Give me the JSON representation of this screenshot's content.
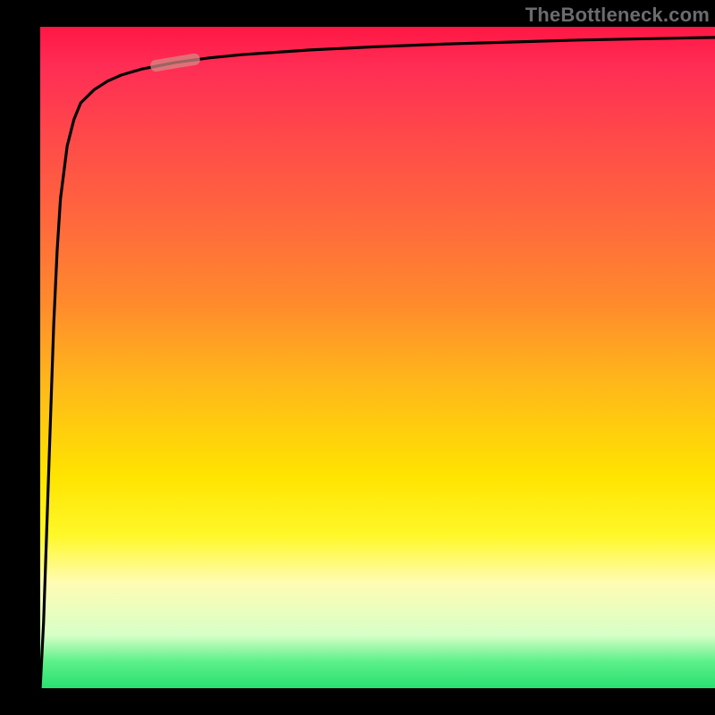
{
  "attribution": "TheBottleneck.com",
  "chart_data": {
    "type": "line",
    "title": "",
    "xlabel": "",
    "ylabel": "",
    "xlim": [
      0,
      100
    ],
    "ylim": [
      0,
      100
    ],
    "background_gradient": {
      "orientation": "vertical",
      "stops": [
        {
          "pos": 0,
          "color": "#ff1744"
        },
        {
          "pos": 30,
          "color": "#ff6a3c"
        },
        {
          "pos": 55,
          "color": "#ffb81a"
        },
        {
          "pos": 75,
          "color": "#fff82a"
        },
        {
          "pos": 92,
          "color": "#d7ffc7"
        },
        {
          "pos": 100,
          "color": "#28e070"
        }
      ]
    },
    "series": [
      {
        "name": "curve",
        "x": [
          0.0,
          0.5,
          1.0,
          1.5,
          2.0,
          2.5,
          3.0,
          4.0,
          5.0,
          6.0,
          8.0,
          10.0,
          12.0,
          15.0,
          20.0,
          25.0,
          30.0,
          40.0,
          50.0,
          60.0,
          70.0,
          80.0,
          90.0,
          100.0
        ],
        "y": [
          0.0,
          10.0,
          25.0,
          40.0,
          55.0,
          66.0,
          74.0,
          82.0,
          86.0,
          88.5,
          90.5,
          91.8,
          92.7,
          93.6,
          94.6,
          95.3,
          95.8,
          96.5,
          97.0,
          97.4,
          97.7,
          98.0,
          98.2,
          98.4
        ]
      }
    ],
    "marker": {
      "x": 20.0,
      "y": 94.6,
      "color": "#d58a86",
      "shape": "capsule"
    }
  }
}
